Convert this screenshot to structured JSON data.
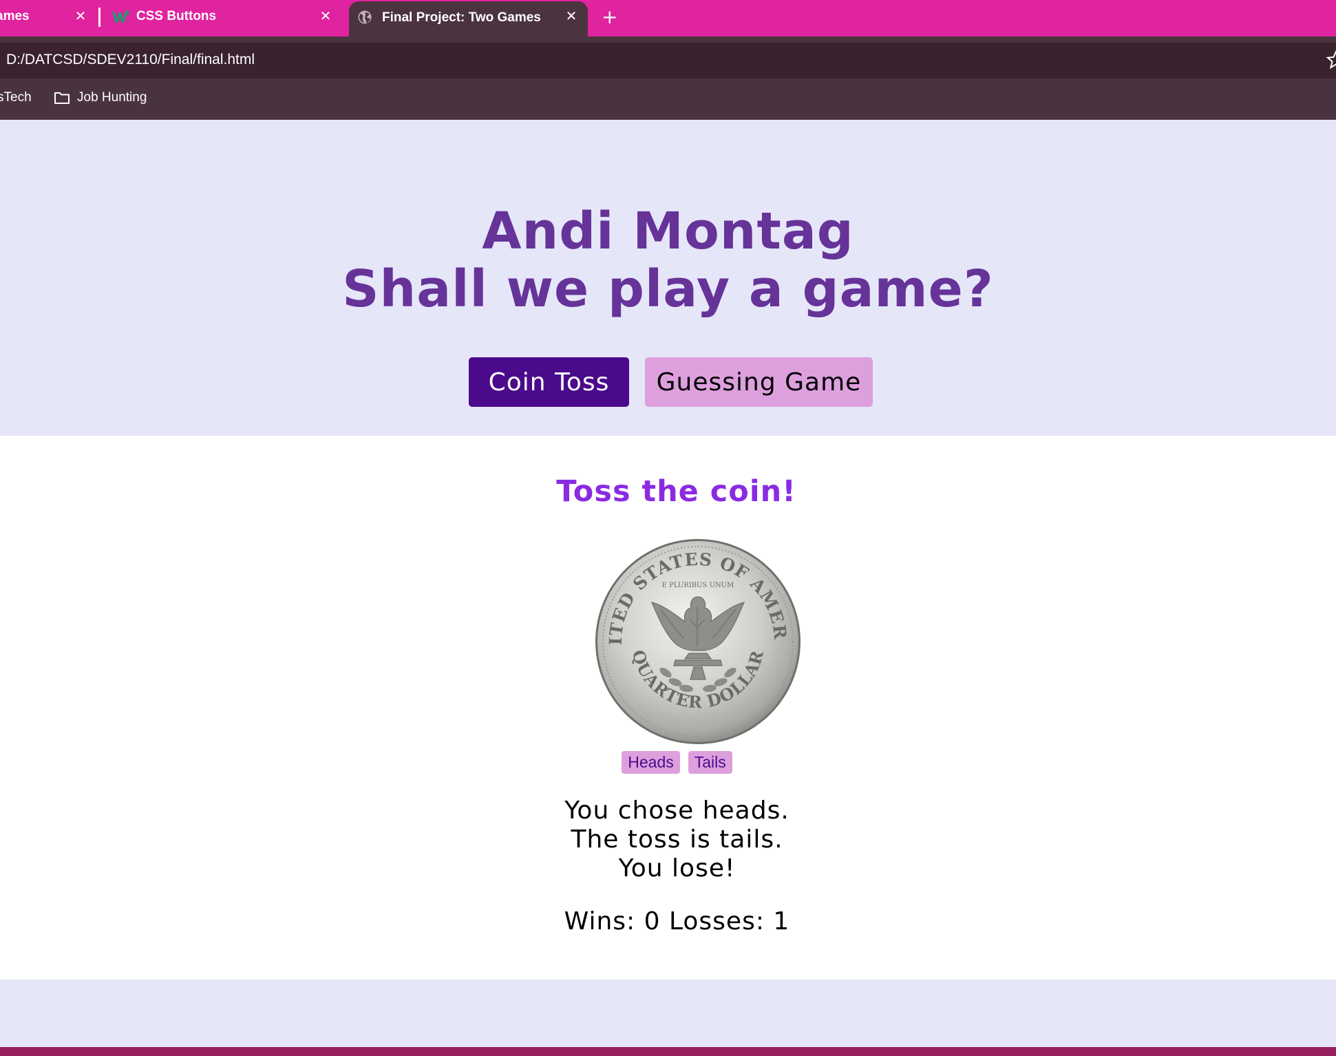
{
  "browser": {
    "tabs": [
      {
        "title": "ames",
        "active": false
      },
      {
        "title": "CSS Buttons",
        "active": false
      },
      {
        "title": "Final Project: Two Games",
        "active": true
      }
    ],
    "close_glyph": "✕",
    "new_tab_glyph": "+",
    "url": "D:/DATCSD/SDEV2110/Final/final.html",
    "bookmarks": [
      {
        "label": "sTech"
      },
      {
        "label": "Job Hunting",
        "icon": "folder-icon"
      }
    ],
    "colors": {
      "tabbar": "#e0239f",
      "active_tab": "#4b3340",
      "address_bar": "#3a222e",
      "bookmarks_bar": "#4a3340"
    }
  },
  "page": {
    "title_line1": "Andi Montag",
    "title_line2": "Shall we play a game?",
    "buttons": {
      "coin_toss": "Coin Toss",
      "guessing_game": "Guessing Game"
    },
    "game": {
      "heading": "Toss the coin!",
      "coin_image": "quarter-reverse-eagle",
      "coin_text_top": "UNITED STATES OF AMERICA",
      "coin_text_bottom": "QUARTER DOLLAR",
      "coin_motto": "E PLURIBUS UNUM",
      "choices": {
        "heads": "Heads",
        "tails": "Tails"
      },
      "result_line1": "You chose heads.",
      "result_line2": "The toss is tails.",
      "result_line3": "You lose!",
      "score": "Wins: 0 Losses: 1"
    },
    "colors": {
      "title": "#663399",
      "heading": "#8a2be2",
      "primary_button": "#4b0a8c",
      "secondary_button": "#dda0dd",
      "panel_bg": "#e6e6f9"
    }
  }
}
